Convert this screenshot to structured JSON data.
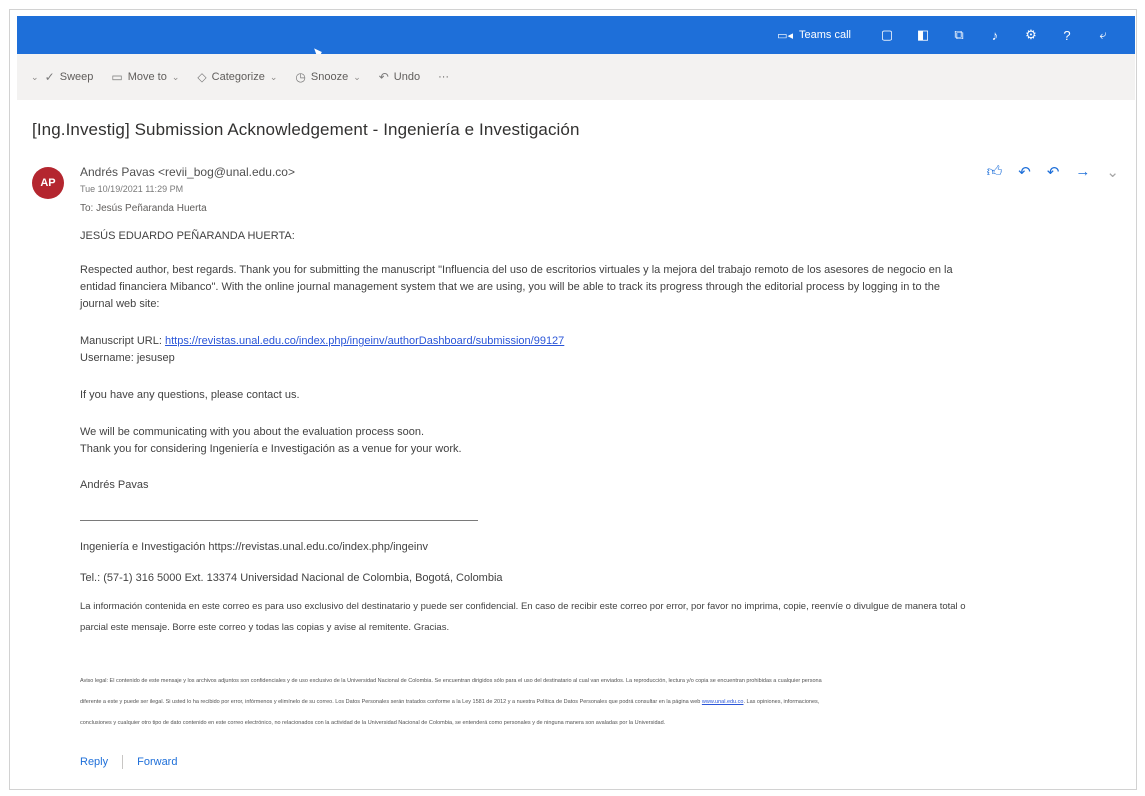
{
  "topbar": {
    "teams_call_label": "Teams call",
    "icons": [
      "teams-video-icon",
      "chat-icon",
      "office-icon",
      "share-icon",
      "bell-icon",
      "gear-icon",
      "help-icon",
      "feedback-icon"
    ],
    "help_glyph": "?"
  },
  "cmdbar": {
    "sweep": "Sweep",
    "move_to": "Move to",
    "categorize": "Categorize",
    "snooze": "Snooze",
    "undo": "Undo",
    "more": "···"
  },
  "message": {
    "subject": "[Ing.Investig] Submission Acknowledgement - Ingeniería e Investigación",
    "avatar_initials": "AP",
    "sender": "Andrés Pavas <revii_bog@unal.edu.co>",
    "date": "Tue 10/19/2021 11:29 PM",
    "to": "To:  Jesús Peñaranda Huerta",
    "salutation": "JESÚS EDUARDO PEÑARANDA HUERTA:",
    "para1_line1": "Respected author, best regards. Thank you for submitting the manuscript \"Influencia del uso de escritorios virtuales y la mejora del trabajo remoto de los asesores de negocio en la",
    "para1_line2": "entidad financiera Mibanco\". With the online journal management system that we are using, you will be able to track its progress through the editorial process by logging in to the",
    "para1_line3": "journal web site:",
    "manuscript_label": "Manuscript URL: ",
    "manuscript_url": "https://revistas.unal.edu.co/index.php/ingeinv/authorDashboard/submission/99127",
    "username": "Username: jesusep",
    "questions": "If you have any questions, please contact us.",
    "communicating": "We will be communicating with you about the evaluation process soon.",
    "thanks": "Thank you for considering Ingeniería e Investigación as a venue for your work.",
    "signature": "Andrés Pavas",
    "journal_line": "Ingeniería e Investigación https://revistas.unal.edu.co/index.php/ingeinv",
    "tel_line": "Tel.: (57-1) 316 5000 Ext. 13374 Universidad Nacional de Colombia, Bogotá, Colombia",
    "confidential_line1": "La información contenida en este correo es para uso exclusivo del destinatario y puede ser confidencial. En caso de recibir este correo por error, por favor no imprima, copie, reenvíe o divulgue de manera total o",
    "confidential_line2": "parcial este mensaje. Borre este correo y todas las copias y avise al remitente. Gracias.",
    "legal_line1": "Aviso legal: El contenido de este mensaje y los archivos adjuntos son confidenciales y de uso exclusivo de la Universidad Nacional de Colombia. Se encuentran dirigidos sólo para el uso del destinatario al cual van enviados. La reproducción, lectura y/o copia se encuentran prohibidas a cualquier persona",
    "legal_line2": "diferente a este y puede ser ilegal. Si usted lo ha recibido por error, infórmenos y elimínelo de su correo. Los Datos Personales serán tratados conforme a la Ley 1581 de 2012 y a nuestra Política de Datos Personales que podrá consultar en la página web ",
    "legal_link": "www.unal.edu.co",
    "legal_line2_tail": ". Las opiniones, informaciones,",
    "legal_line3": "conclusiones y cualquier otro tipo de dato contenido en este correo electrónico, no relacionados con la actividad de la Universidad Nacional de Colombia, se entenderá como personales y de ninguna manera son avaladas por la Universidad.",
    "reply": "Reply",
    "forward": "Forward"
  },
  "colors": {
    "topbar": "#1e6fd9",
    "avatar": "#b4262f",
    "link": "#2b56d8"
  }
}
